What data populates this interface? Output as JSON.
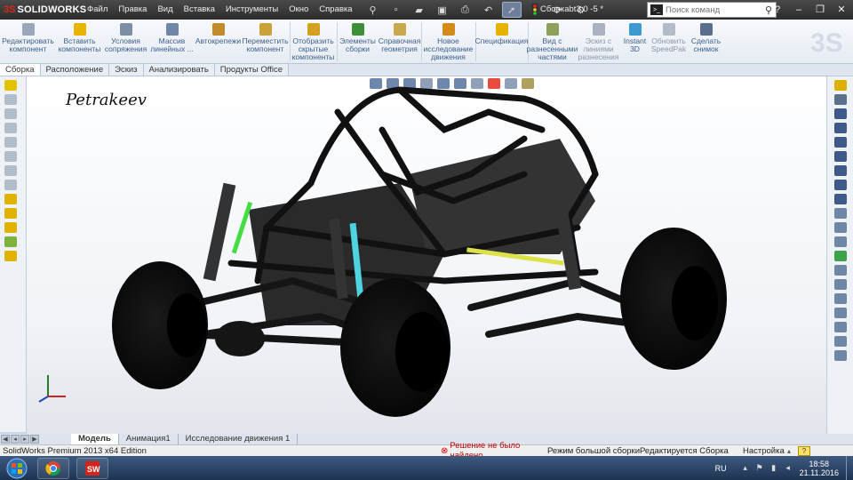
{
  "titlebar": {
    "brand_prefix": "3S",
    "brand_name": "SOLIDWORKS",
    "menu": [
      "Файл",
      "Правка",
      "Вид",
      "Вставка",
      "Инструменты",
      "Окно",
      "Справка"
    ],
    "document_title": "Сборкаbt3.0 -5 *",
    "search_placeholder": "Поиск команд"
  },
  "ribbon": {
    "buttons": [
      {
        "label": "Редактировать компонент",
        "dim": false,
        "icon": "edit-component-icon",
        "color": "#9aa7b8"
      },
      {
        "label": "Вставить компоненты",
        "dim": false,
        "icon": "insert-components-icon",
        "color": "#e8b400"
      },
      {
        "label": "Условия сопряжения",
        "dim": false,
        "icon": "mate-icon",
        "color": "#7d8da3"
      },
      {
        "label": "Массив линейных ...",
        "dim": false,
        "icon": "linear-pattern-icon",
        "color": "#6f86a6"
      },
      {
        "label": "Автокрепежи",
        "dim": false,
        "icon": "smart-fasteners-icon",
        "color": "#c28a2a"
      },
      {
        "label": "Переместить компонент",
        "dim": false,
        "icon": "move-component-icon",
        "color": "#c9a23a"
      },
      {
        "label": "Отобразить скрытые компоненты",
        "dim": false,
        "icon": "show-hidden-icon",
        "color": "#d4a020"
      },
      {
        "label": "Элементы сборки",
        "dim": false,
        "icon": "assembly-features-icon",
        "color": "#3f8f3a"
      },
      {
        "label": "Справочная геометрия",
        "dim": false,
        "icon": "reference-geometry-icon",
        "color": "#c8a94d"
      },
      {
        "label": "Новое исследование движения",
        "dim": false,
        "icon": "motion-study-icon",
        "color": "#d48a1a"
      },
      {
        "label": "Спецификация",
        "dim": false,
        "icon": "bom-icon",
        "color": "#e6b400"
      },
      {
        "label": "Вид с разнесенными частями",
        "dim": false,
        "icon": "exploded-view-icon",
        "color": "#8ea05a"
      },
      {
        "label": "Эскиз с линиями разнесения",
        "dim": true,
        "icon": "explode-line-sketch-icon",
        "color": "#a8b2c0"
      },
      {
        "label": "Instant 3D",
        "dim": false,
        "icon": "instant3d-icon",
        "color": "#3d9ad1"
      },
      {
        "label": "Обновить SpeedPak",
        "dim": true,
        "icon": "speedpak-icon",
        "color": "#b2bbc8"
      },
      {
        "label": "Сделать снимок",
        "dim": false,
        "icon": "snapshot-icon",
        "color": "#5a6f8c"
      }
    ]
  },
  "tabs": [
    "Сборка",
    "Расположение",
    "Эскиз",
    "Анализировать",
    "Продукты Office"
  ],
  "viewport": {
    "watermark": "Petrakeev"
  },
  "bottom_tabs": [
    "Модель",
    "Анимация1",
    "Исследование движения 1"
  ],
  "status": {
    "app": "SolidWorks Premium 2013 x64 Edition",
    "error": "Решение не было найдено",
    "large_assembly": "Режим большой сборки",
    "editing": "Редактируется Сборка",
    "units": "Настройка",
    "help": "?"
  },
  "taskbar": {
    "lang": "RU",
    "time": "18:58",
    "date": "21.11.2016"
  },
  "colors": {
    "titlebar_dark": "#2c2c2c",
    "brand_red": "#e2231a",
    "ribbon_text": "#3b5f8a",
    "error_red": "#b00000"
  }
}
